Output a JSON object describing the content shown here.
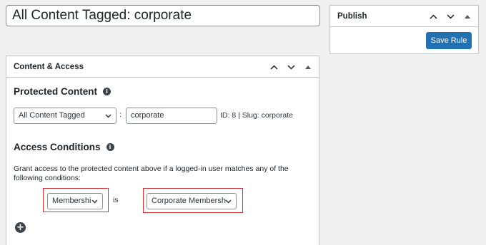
{
  "title_field": {
    "value": "All Content Tagged: corporate"
  },
  "publish_box": {
    "title": "Publish",
    "save_button": "Save Rule"
  },
  "content_access_box": {
    "title": "Content & Access",
    "protected_content": {
      "heading": "Protected Content",
      "type_select": "All Content Tagged",
      "separator": ":",
      "tag_value": "corporate",
      "meta": "ID: 8 | Slug: corporate"
    },
    "access_conditions": {
      "heading": "Access Conditions",
      "description": "Grant access to the protected content above if a logged-in user matches any of the following conditions:",
      "condition_type_select": "Membershi",
      "operator": "is",
      "condition_value_select": "Corporate Membersh"
    }
  },
  "icons": {
    "move_up": "chevron-up-icon",
    "move_down": "chevron-down-icon",
    "toggle": "triangle-up-icon",
    "info": "info-icon",
    "add": "plus-circle-icon"
  },
  "colors": {
    "primary_button": "#2271b1",
    "highlight": "#d63638",
    "background": "#f0f0f1"
  }
}
